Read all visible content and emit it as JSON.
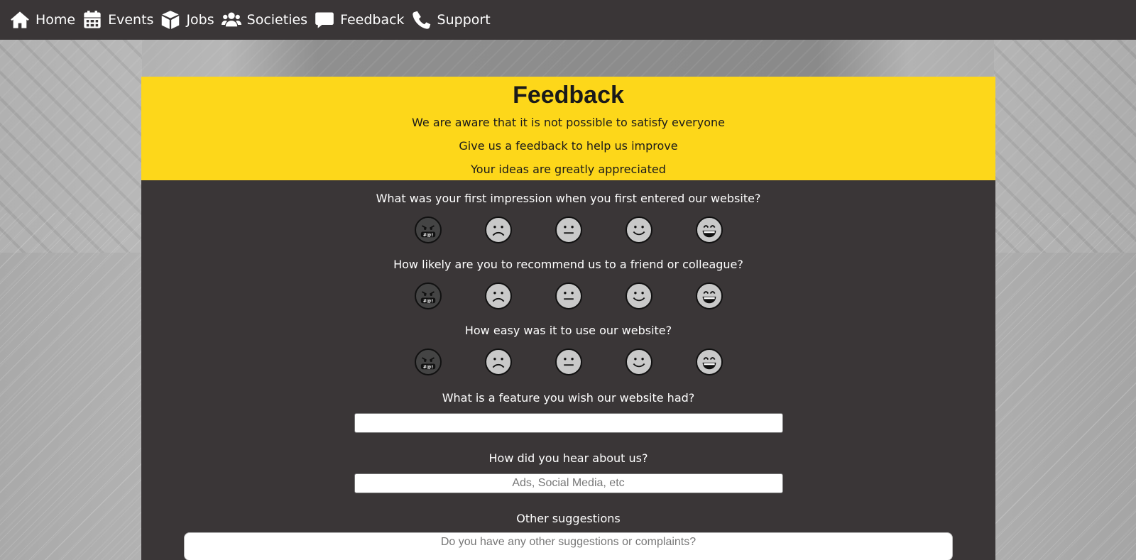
{
  "nav": {
    "items": [
      {
        "label": "Home",
        "icon": "home-icon"
      },
      {
        "label": "Events",
        "icon": "calendar-icon"
      },
      {
        "label": "Jobs",
        "icon": "box-icon"
      },
      {
        "label": "Societies",
        "icon": "users-icon"
      },
      {
        "label": "Feedback",
        "icon": "comment-icon"
      },
      {
        "label": "Support",
        "icon": "phone-icon"
      }
    ]
  },
  "header": {
    "title": "Feedback",
    "lines": [
      "We are aware that it is not possible to satisfy everyone",
      "Give us a feedback to help us improve",
      "Your ideas are greatly appreciated"
    ]
  },
  "questions": {
    "q1": "What was your first impression when you first entered our website?",
    "q2": "How likely are you to recommend us to a friend or colleague?",
    "q3": "How easy was it to use our website?",
    "q4": "What is a feature you wish our website had?",
    "q5": "How did you hear about us?",
    "q6": "Other suggestions"
  },
  "rating_faces": [
    "angry-face-icon",
    "sad-face-icon",
    "neutral-face-icon",
    "smile-face-icon",
    "grin-face-icon"
  ],
  "inputs": {
    "feature_value": "",
    "hear_placeholder": "Ads, Social Media, etc",
    "suggestions_placeholder": "Do you have any other suggestions or complaints?"
  },
  "colors": {
    "nav_bg": "#3a3637",
    "accent_yellow": "#fdd71a",
    "card_bg": "#3a3637"
  }
}
